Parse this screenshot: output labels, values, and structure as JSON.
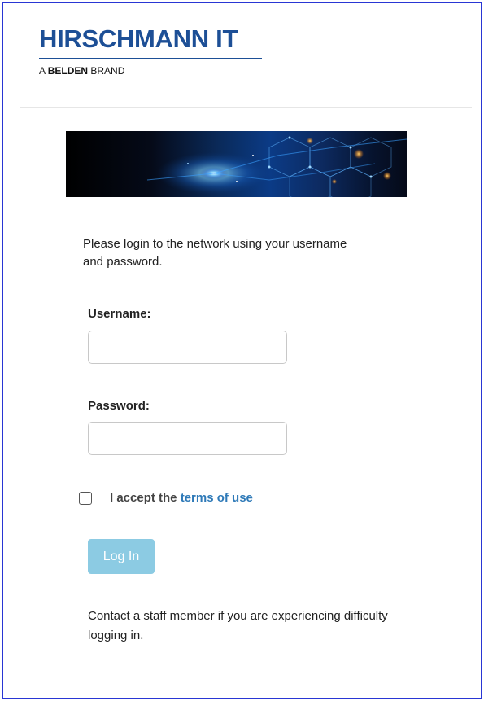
{
  "header": {
    "logo_title": "HIRSCHMANN IT",
    "logo_sub_pre": "A ",
    "logo_sub_brand": "BELDEN",
    "logo_sub_post": " BRAND"
  },
  "banner": {
    "icon": "network-banner-image"
  },
  "login": {
    "intro": "Please login to the network using your username and password.",
    "username_label": "Username:",
    "username_value": "",
    "password_label": "Password:",
    "password_value": "",
    "accept_prefix": "I accept the ",
    "terms_link": "terms of use",
    "accept_checked": false,
    "login_button": "Log In",
    "contact": "Contact a staff member if you are experiencing difficulty logging in."
  },
  "colors": {
    "brand_blue": "#1d4f96",
    "frame_border": "#2936d4",
    "link": "#2f7ab8",
    "button_disabled": "#8ccbe3"
  }
}
